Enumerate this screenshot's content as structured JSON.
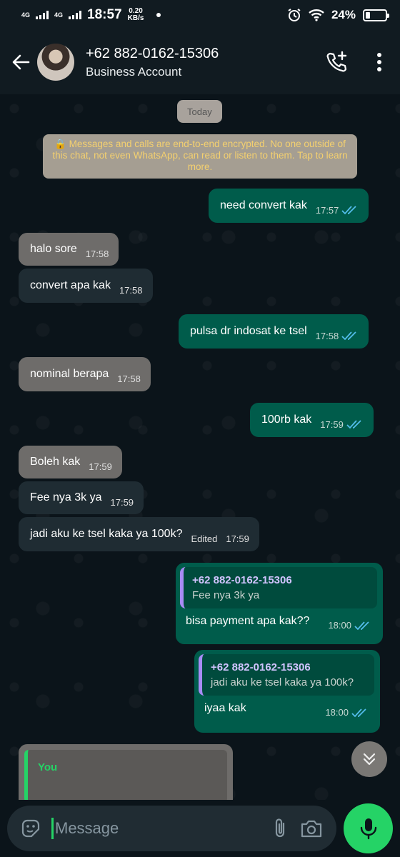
{
  "status_bar": {
    "net1": "4G",
    "net2": "4G",
    "time": "18:57",
    "speed_value": "0.20",
    "speed_unit": "KB/s",
    "battery": "24%",
    "battery_level": 0.24
  },
  "header": {
    "title": "+62 882-0162-15306",
    "subtitle": "Business Account"
  },
  "chat": {
    "date_chip": "Today",
    "encryption_notice": "🔒 Messages and calls are end-to-end encrypted. No one outside of this chat, not even WhatsApp, can read or listen to them. Tap to learn more.",
    "messages": [
      {
        "dir": "out",
        "text": "need convert kak",
        "time": "17:57"
      },
      {
        "dir": "in",
        "text": "halo sore",
        "time": "17:58"
      },
      {
        "dir": "in",
        "text": "convert apa kak",
        "time": "17:58"
      },
      {
        "dir": "out",
        "text": "pulsa dr indosat ke tsel",
        "time": "17:58"
      },
      {
        "dir": "in",
        "text": "nominal berapa",
        "time": "17:58"
      },
      {
        "dir": "out",
        "text": "100rb kak",
        "time": "17:59"
      },
      {
        "dir": "in",
        "text": "Boleh kak",
        "time": "17:59"
      },
      {
        "dir": "in",
        "text": "Fee nya 3k ya",
        "time": "17:59"
      },
      {
        "dir": "in",
        "text": "jadi aku ke tsel kaka ya 100k?",
        "time": "17:59",
        "edited": "Edited"
      },
      {
        "dir": "out",
        "quote_name": "+62 882-0162-15306",
        "quote_text": "Fee nya 3k ya",
        "text": "bisa payment apa kak??",
        "time": "18:00"
      },
      {
        "dir": "out",
        "quote_name": "+62 882-0162-15306",
        "quote_text": "jadi aku ke tsel kaka ya 100k?",
        "text": "iyaa kak",
        "time": "18:00"
      }
    ],
    "partial_quote_name": "You"
  },
  "input": {
    "placeholder": "Message"
  },
  "colors": {
    "outgoing": "#005c4b",
    "incoming": "#6e6c6a",
    "accent": "#25d366",
    "read_ticks": "#53bdeb"
  },
  "icons": [
    "back-arrow-icon",
    "add-call-icon",
    "more-vert-icon",
    "double-check-icon",
    "chevron-down-icon",
    "sticker-icon",
    "attach-icon",
    "camera-icon",
    "mic-icon"
  ]
}
